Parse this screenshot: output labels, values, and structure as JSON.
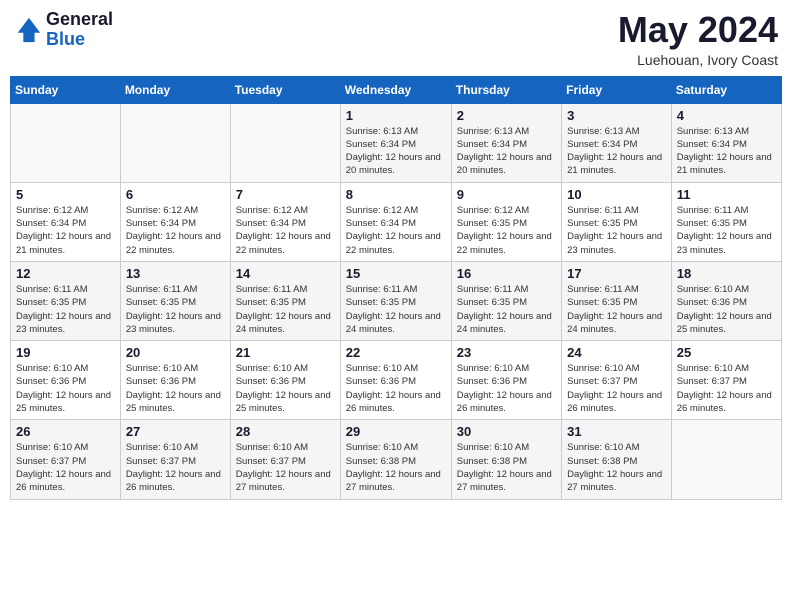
{
  "header": {
    "logo_line1": "General",
    "logo_line2": "Blue",
    "month_title": "May 2024",
    "location": "Luehouan, Ivory Coast"
  },
  "weekdays": [
    "Sunday",
    "Monday",
    "Tuesday",
    "Wednesday",
    "Thursday",
    "Friday",
    "Saturday"
  ],
  "weeks": [
    [
      {
        "day": "",
        "info": ""
      },
      {
        "day": "",
        "info": ""
      },
      {
        "day": "",
        "info": ""
      },
      {
        "day": "1",
        "info": "Sunrise: 6:13 AM\nSunset: 6:34 PM\nDaylight: 12 hours\nand 20 minutes."
      },
      {
        "day": "2",
        "info": "Sunrise: 6:13 AM\nSunset: 6:34 PM\nDaylight: 12 hours\nand 20 minutes."
      },
      {
        "day": "3",
        "info": "Sunrise: 6:13 AM\nSunset: 6:34 PM\nDaylight: 12 hours\nand 21 minutes."
      },
      {
        "day": "4",
        "info": "Sunrise: 6:13 AM\nSunset: 6:34 PM\nDaylight: 12 hours\nand 21 minutes."
      }
    ],
    [
      {
        "day": "5",
        "info": "Sunrise: 6:12 AM\nSunset: 6:34 PM\nDaylight: 12 hours\nand 21 minutes."
      },
      {
        "day": "6",
        "info": "Sunrise: 6:12 AM\nSunset: 6:34 PM\nDaylight: 12 hours\nand 22 minutes."
      },
      {
        "day": "7",
        "info": "Sunrise: 6:12 AM\nSunset: 6:34 PM\nDaylight: 12 hours\nand 22 minutes."
      },
      {
        "day": "8",
        "info": "Sunrise: 6:12 AM\nSunset: 6:34 PM\nDaylight: 12 hours\nand 22 minutes."
      },
      {
        "day": "9",
        "info": "Sunrise: 6:12 AM\nSunset: 6:35 PM\nDaylight: 12 hours\nand 22 minutes."
      },
      {
        "day": "10",
        "info": "Sunrise: 6:11 AM\nSunset: 6:35 PM\nDaylight: 12 hours\nand 23 minutes."
      },
      {
        "day": "11",
        "info": "Sunrise: 6:11 AM\nSunset: 6:35 PM\nDaylight: 12 hours\nand 23 minutes."
      }
    ],
    [
      {
        "day": "12",
        "info": "Sunrise: 6:11 AM\nSunset: 6:35 PM\nDaylight: 12 hours\nand 23 minutes."
      },
      {
        "day": "13",
        "info": "Sunrise: 6:11 AM\nSunset: 6:35 PM\nDaylight: 12 hours\nand 23 minutes."
      },
      {
        "day": "14",
        "info": "Sunrise: 6:11 AM\nSunset: 6:35 PM\nDaylight: 12 hours\nand 24 minutes."
      },
      {
        "day": "15",
        "info": "Sunrise: 6:11 AM\nSunset: 6:35 PM\nDaylight: 12 hours\nand 24 minutes."
      },
      {
        "day": "16",
        "info": "Sunrise: 6:11 AM\nSunset: 6:35 PM\nDaylight: 12 hours\nand 24 minutes."
      },
      {
        "day": "17",
        "info": "Sunrise: 6:11 AM\nSunset: 6:35 PM\nDaylight: 12 hours\nand 24 minutes."
      },
      {
        "day": "18",
        "info": "Sunrise: 6:10 AM\nSunset: 6:36 PM\nDaylight: 12 hours\nand 25 minutes."
      }
    ],
    [
      {
        "day": "19",
        "info": "Sunrise: 6:10 AM\nSunset: 6:36 PM\nDaylight: 12 hours\nand 25 minutes."
      },
      {
        "day": "20",
        "info": "Sunrise: 6:10 AM\nSunset: 6:36 PM\nDaylight: 12 hours\nand 25 minutes."
      },
      {
        "day": "21",
        "info": "Sunrise: 6:10 AM\nSunset: 6:36 PM\nDaylight: 12 hours\nand 25 minutes."
      },
      {
        "day": "22",
        "info": "Sunrise: 6:10 AM\nSunset: 6:36 PM\nDaylight: 12 hours\nand 26 minutes."
      },
      {
        "day": "23",
        "info": "Sunrise: 6:10 AM\nSunset: 6:36 PM\nDaylight: 12 hours\nand 26 minutes."
      },
      {
        "day": "24",
        "info": "Sunrise: 6:10 AM\nSunset: 6:37 PM\nDaylight: 12 hours\nand 26 minutes."
      },
      {
        "day": "25",
        "info": "Sunrise: 6:10 AM\nSunset: 6:37 PM\nDaylight: 12 hours\nand 26 minutes."
      }
    ],
    [
      {
        "day": "26",
        "info": "Sunrise: 6:10 AM\nSunset: 6:37 PM\nDaylight: 12 hours\nand 26 minutes."
      },
      {
        "day": "27",
        "info": "Sunrise: 6:10 AM\nSunset: 6:37 PM\nDaylight: 12 hours\nand 26 minutes."
      },
      {
        "day": "28",
        "info": "Sunrise: 6:10 AM\nSunset: 6:37 PM\nDaylight: 12 hours\nand 27 minutes."
      },
      {
        "day": "29",
        "info": "Sunrise: 6:10 AM\nSunset: 6:38 PM\nDaylight: 12 hours\nand 27 minutes."
      },
      {
        "day": "30",
        "info": "Sunrise: 6:10 AM\nSunset: 6:38 PM\nDaylight: 12 hours\nand 27 minutes."
      },
      {
        "day": "31",
        "info": "Sunrise: 6:10 AM\nSunset: 6:38 PM\nDaylight: 12 hours\nand 27 minutes."
      },
      {
        "day": "",
        "info": ""
      }
    ]
  ]
}
